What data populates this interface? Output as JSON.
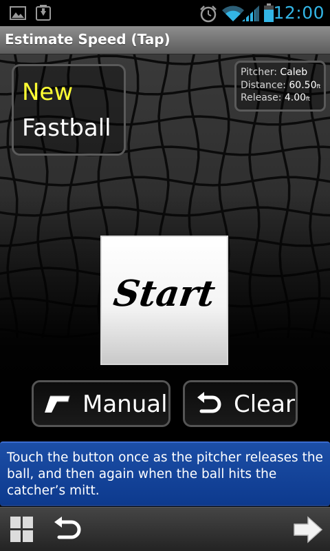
{
  "status_bar": {
    "time": "12:00",
    "icons": [
      "image-icon",
      "download-icon",
      "alarm-icon",
      "wifi-icon",
      "signal-icon",
      "battery-icon"
    ]
  },
  "title_bar": {
    "title": "Estimate Speed (Tap)"
  },
  "pitch": {
    "status": "New",
    "type": "Fastball",
    "status_color": "#ffff33"
  },
  "pitcher_info": {
    "pitcher_label": "Pitcher:",
    "pitcher_value": "Caleb",
    "distance_label": "Distance:",
    "distance_value": "60.50",
    "distance_unit": "ft",
    "release_label": "Release:",
    "release_value": "4.00",
    "release_unit": "ft"
  },
  "start_button": {
    "label": "Start"
  },
  "actions": {
    "manual_label": "Manual",
    "manual_icon": "radar-gun-icon",
    "clear_label": "Clear",
    "clear_icon": "undo-icon"
  },
  "help": {
    "text": "Touch the button once as the pitcher releases the ball, and then again when the ball hits the catcher’s mitt."
  },
  "bottom_bar": {
    "icons": [
      "windows-grid-icon",
      "back-icon",
      "forward-icon"
    ]
  },
  "colors": {
    "accent": "#33b5e5",
    "help_background": "#1c4ea6"
  }
}
